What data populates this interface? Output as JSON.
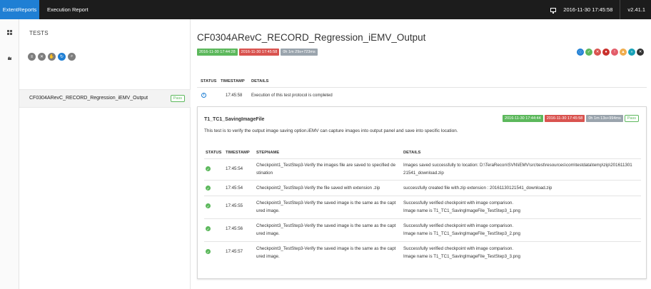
{
  "topbar": {
    "brand": "ExtentReports",
    "tab": "Execution Report",
    "datetime": "2016-11-30 17:45:58",
    "version": "v2.41.1",
    "monitor_icon": "monitor-icon"
  },
  "sidebar": {
    "heading": "TESTS",
    "filter_icons": [
      "list-icon",
      "close-icon",
      "hand-icon",
      "refresh-icon",
      "search-icon"
    ],
    "test_item": {
      "name": "CF0304ARevC_RECORD_Regression_iEMV_Output",
      "status": "Pass"
    }
  },
  "main": {
    "title": "CF0304ARevC_RECORD_Regression_iEMV_Output",
    "tags": {
      "start": "2016-11-30 17:44:28",
      "end": "2016-11-30 17:45:58",
      "duration": "0h 1m 29s+723ms"
    },
    "status_circles": [
      {
        "icon": "info-icon",
        "color": "#1f7fd4"
      },
      {
        "icon": "check-icon",
        "color": "#5cb85c"
      },
      {
        "icon": "fail-icon",
        "color": "#d9534f"
      },
      {
        "icon": "fatal-icon",
        "color": "#c9302c"
      },
      {
        "icon": "error-icon",
        "color": "#e35d6a"
      },
      {
        "icon": "warning-icon",
        "color": "#f0ad4e"
      },
      {
        "icon": "skip-icon",
        "color": "#17a2b8"
      },
      {
        "icon": "unknown-icon",
        "color": "#333333"
      }
    ],
    "log_headers": {
      "status": "STATUS",
      "timestamp": "TIMESTAMP",
      "details": "DETAILS"
    },
    "log_row": {
      "timestamp": "17:45:58",
      "details": "Execution of this test protocol is completed"
    }
  },
  "node": {
    "title": "T1_TC1_SavingImageFile",
    "description": "This test is to verify the output image saving option.iEMV can capture images into output panel and save into specific location.",
    "tags": {
      "start": "2016-11-30 17:44:44",
      "end": "2016-11-30 17:45:58",
      "duration": "0h 1m 13s+994ms",
      "status": "Pass"
    },
    "headers": {
      "status": "STATUS",
      "timestamp": "TIMESTAMP",
      "stepname": "STEPNAME",
      "details": "DETAILS"
    },
    "steps": [
      {
        "timestamp": "17:45:54",
        "step1": "Checkpoint1_TestStep3-Verify the images file are saved to specified de",
        "step2": "stination",
        "detail1": "Images saved successfully to location: D:\\TeraRecon\\SVN\\iEMV\\src\\test\\resources\\com\\testdata\\temp\\zip\\201611301",
        "detail2": "21541_download.zip"
      },
      {
        "timestamp": "17:45:54",
        "step1": "Checkpoint2_TestStep3-Verify the file saved with extension .zip",
        "step2": "",
        "detail1": "successfully created file with.zip extension : 20161130121541_download.zip",
        "detail2": ""
      },
      {
        "timestamp": "17:45:55",
        "step1": "Checkpoint3_TestStep3-Verify the saved image is the same as the capt",
        "step2": "ured image.",
        "detail1": "Successfully verified checkpoint with image comparison.",
        "detail2": "Image name is T1_TC1_SavingImageFile_TestStep3_1.png"
      },
      {
        "timestamp": "17:45:56",
        "step1": "Checkpoint3_TestStep3-Verify the saved image is the same as the capt",
        "step2": "ured image.",
        "detail1": "Successfully verified checkpoint with image comparison.",
        "detail2": "Image name is T1_TC1_SavingImageFile_TestStep3_2.png"
      },
      {
        "timestamp": "17:45:57",
        "step1": "Checkpoint3_TestStep3-Verify the saved image is the same as the capt",
        "step2": "ured image.",
        "detail1": "Successfully verified checkpoint with image comparison.",
        "detail2": "Image name is T1_TC1_SavingImageFile_TestStep3_3.png"
      }
    ]
  }
}
